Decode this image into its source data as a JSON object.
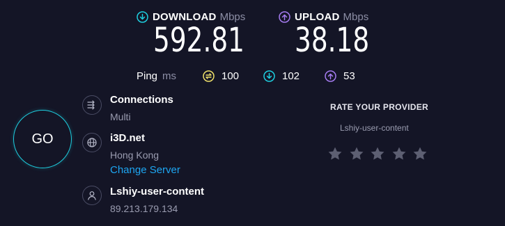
{
  "download": {
    "label": "DOWNLOAD",
    "unit": "Mbps",
    "value": "592.81"
  },
  "upload": {
    "label": "UPLOAD",
    "unit": "Mbps",
    "value": "38.18"
  },
  "ping": {
    "label": "Ping",
    "unit": "ms",
    "idle": "100",
    "down": "102",
    "up": "53"
  },
  "go_label": "GO",
  "connections": {
    "title": "Connections",
    "value": "Multi"
  },
  "server": {
    "name": "i3D.net",
    "location": "Hong Kong",
    "change_label": "Change Server"
  },
  "user": {
    "name": "Lshiy-user-content",
    "ip": "89.213.179.134"
  },
  "rating": {
    "heading": "RATE YOUR PROVIDER",
    "provider": "Lshiy-user-content",
    "stars_total": 5,
    "stars_selected": 0
  },
  "colors": {
    "background": "#141526",
    "download_accent": "#1ecfe0",
    "upload_accent": "#a67cf2",
    "idle_accent": "#f0e16a",
    "link": "#1da6f2",
    "star": "#5d5f72"
  },
  "icons": {
    "download": "arrow-down-circle-icon",
    "upload": "arrow-up-circle-icon",
    "idle": "jitter-circle-icon",
    "connections": "connections-icon",
    "server": "globe-icon",
    "user": "person-icon",
    "star": "star-icon"
  }
}
